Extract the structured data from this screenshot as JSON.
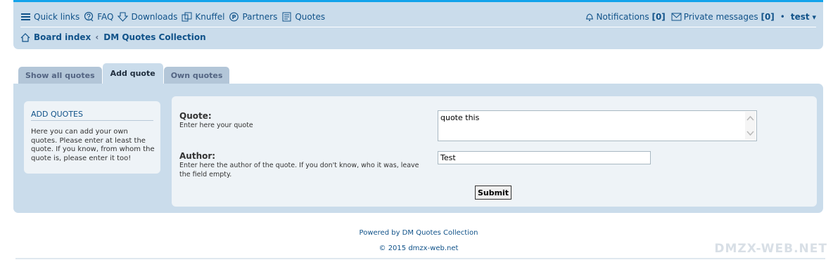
{
  "nav": {
    "links": [
      {
        "label": "Quick links",
        "icon": "hamburger-icon"
      },
      {
        "label": "FAQ",
        "icon": "faq-icon"
      },
      {
        "label": "Downloads",
        "icon": "download-icon"
      },
      {
        "label": "Knuffel",
        "icon": "knuffel-icon"
      },
      {
        "label": "Partners",
        "icon": "partners-icon"
      },
      {
        "label": "Quotes",
        "icon": "quotes-icon"
      }
    ],
    "notifications_label": "Notifications",
    "notifications_count": "[0]",
    "pm_label": "Private messages",
    "pm_count": "[0]",
    "bullet": "•",
    "username": "test",
    "caret": "▾"
  },
  "breadcrumb": {
    "home": "Board index",
    "separator": "‹",
    "current": "DM Quotes Collection"
  },
  "tabs": [
    {
      "label": "Show all quotes",
      "active": false
    },
    {
      "label": "Add quote",
      "active": true
    },
    {
      "label": "Own quotes",
      "active": false
    }
  ],
  "sidebox": {
    "title": "ADD QUOTES",
    "text": "Here you can add your own quotes. Please enter at least the quote. If you know, from whom the quote is, please enter it too!"
  },
  "form": {
    "quote_label": "Quote:",
    "quote_hint": "Enter here your quote",
    "quote_value": "quote this",
    "author_label": "Author:",
    "author_hint": "Enter here the author of the quote. If you don't know, who it was, leave the field empty.",
    "author_value": "Test",
    "submit_label": "Submit"
  },
  "footer": {
    "powered": "Powered by DM Quotes Collection",
    "copyright": "© 2015 dmzx-web.net"
  },
  "watermark": "DMZX-WEB.NET",
  "colors": {
    "accent": "#12a3eb",
    "link": "#105289",
    "panel": "#cadceb",
    "box": "#eef3f7"
  }
}
